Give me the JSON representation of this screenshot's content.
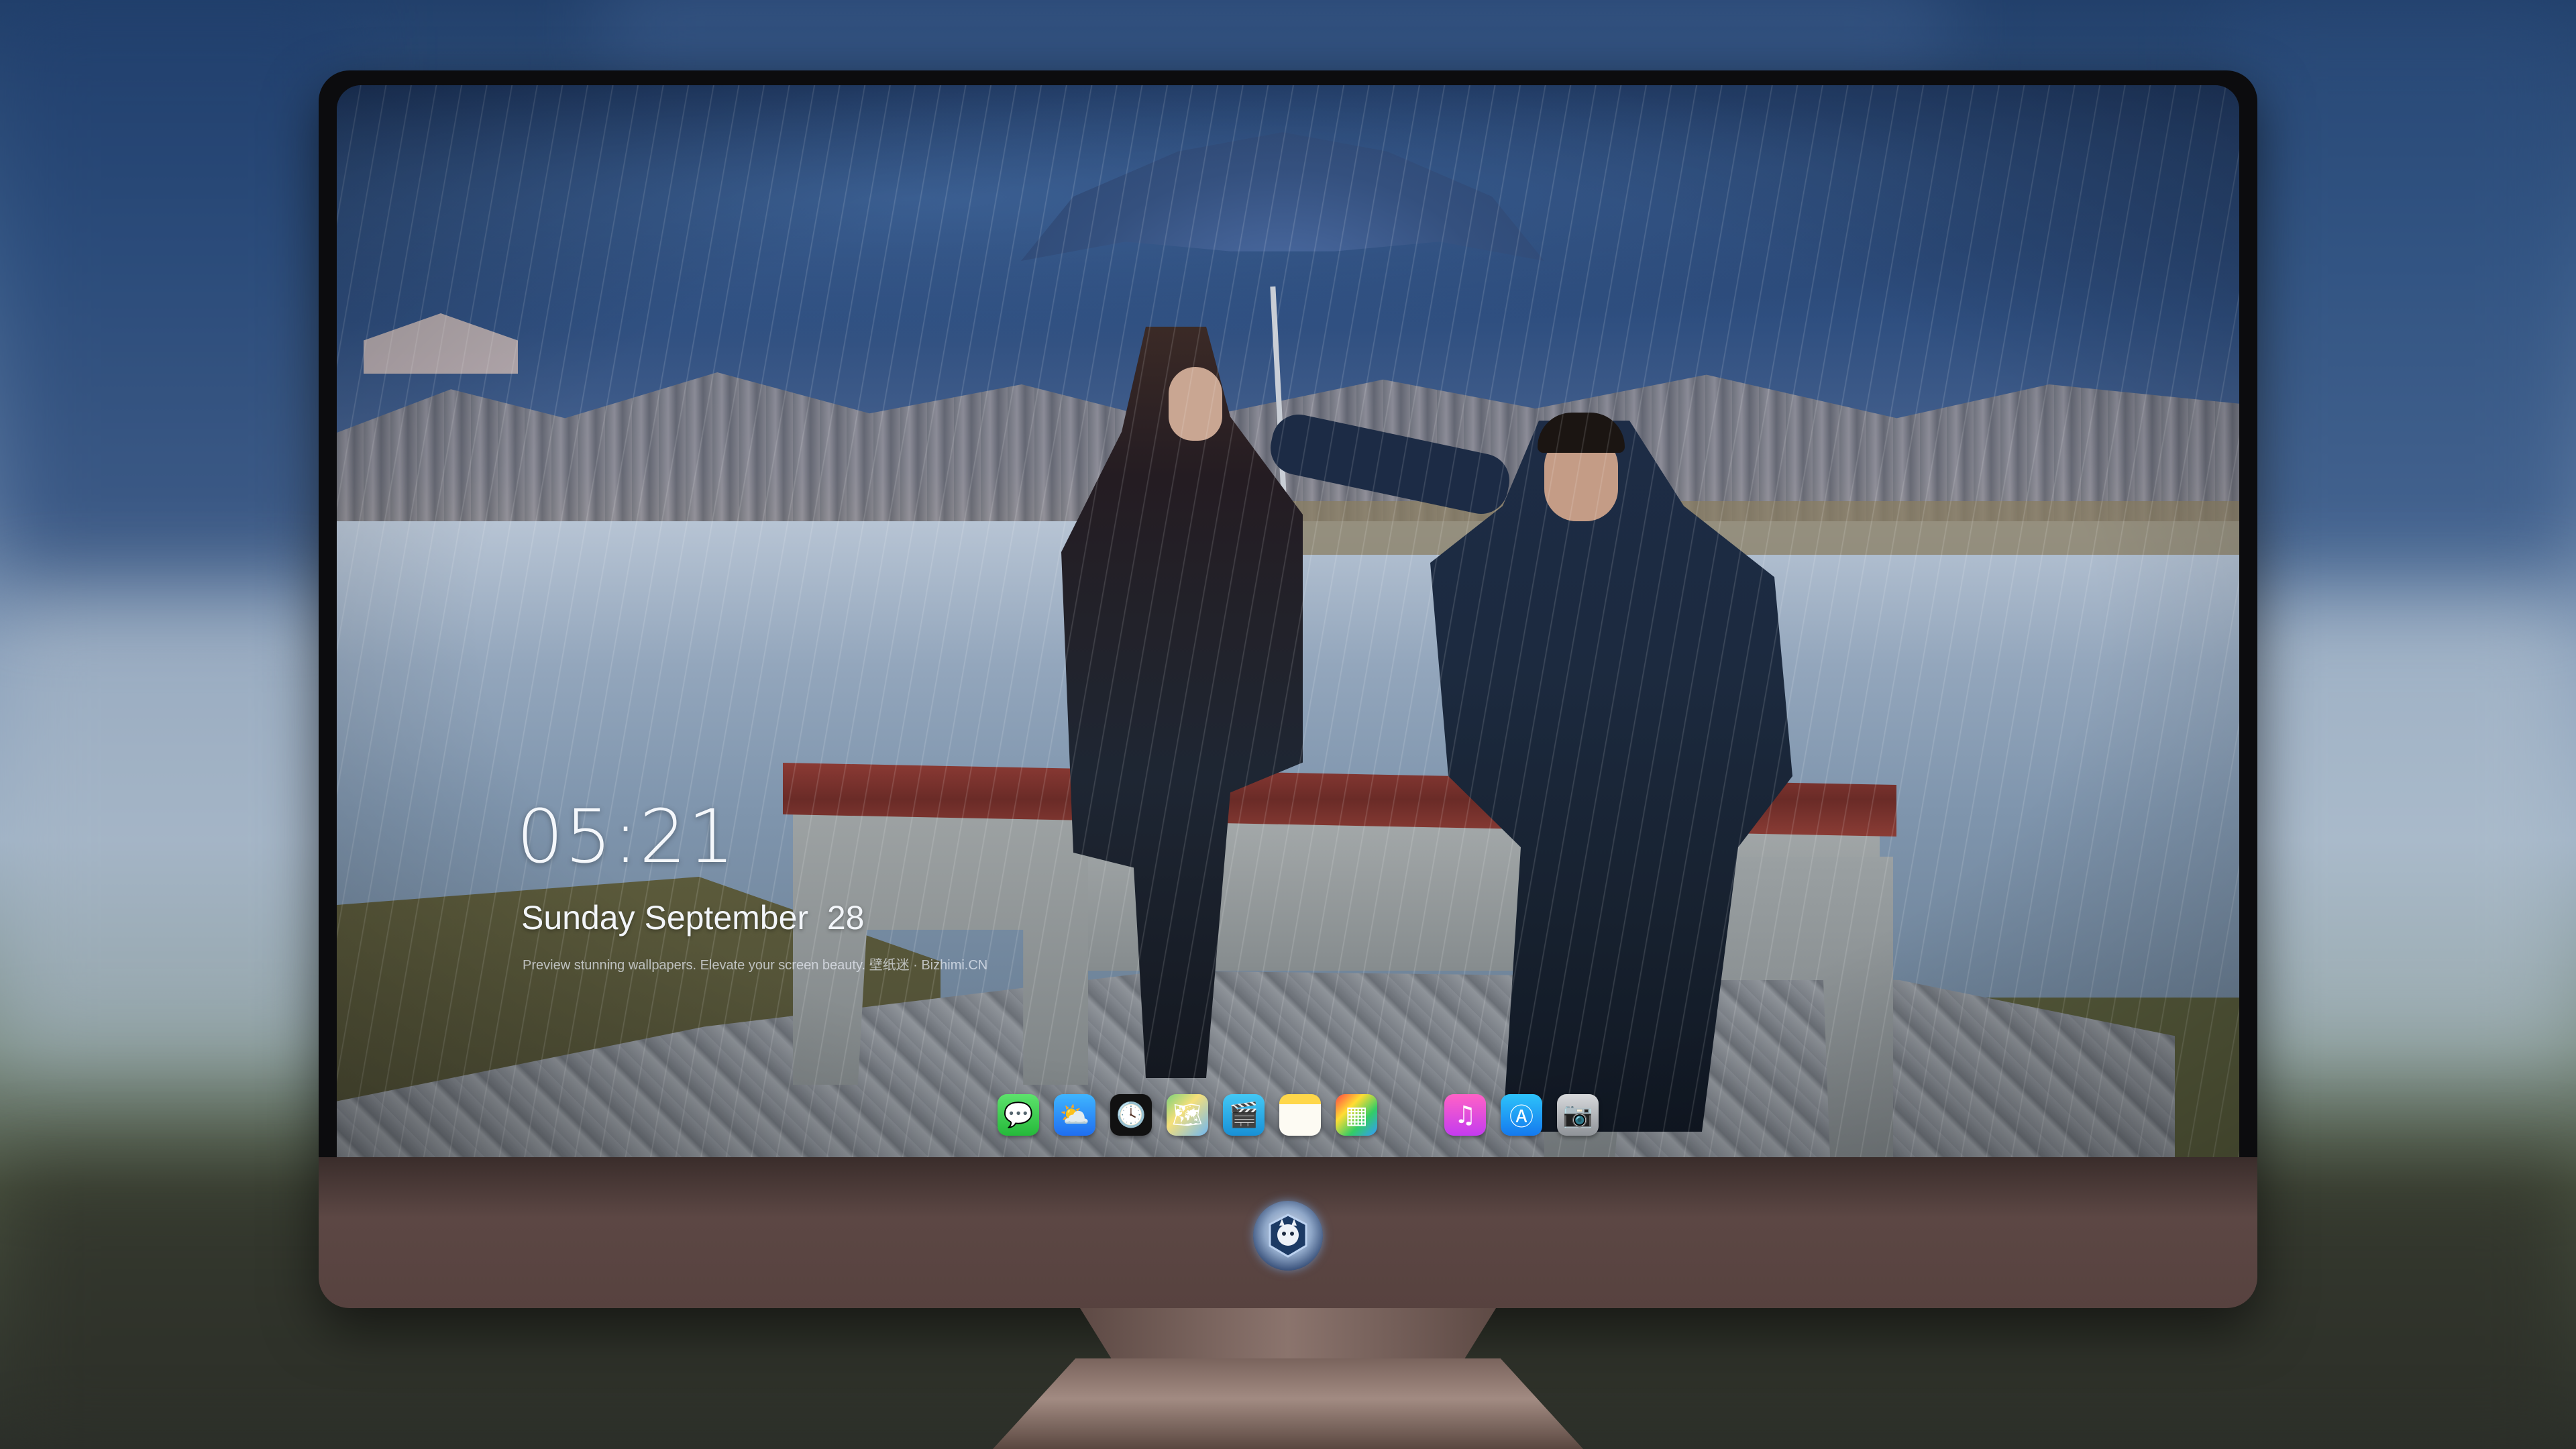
{
  "lock_screen": {
    "time": "05:21",
    "date": "Sunday September  28",
    "credit": "Preview stunning wallpapers. Elevate your screen beauty. 壁纸迷 · Bizhimi.CN"
  },
  "dock": {
    "apps": [
      {
        "name": "Messages",
        "icon": "message-bubble-icon",
        "glyph": "💬"
      },
      {
        "name": "Weather",
        "icon": "weather-cloud-icon",
        "glyph": "⛅"
      },
      {
        "name": "Clock",
        "icon": "clock-icon",
        "glyph": "🕓"
      },
      {
        "name": "Maps",
        "icon": "map-icon",
        "glyph": "🗺"
      },
      {
        "name": "Clips",
        "icon": "clapperboard-icon",
        "glyph": "🎬"
      },
      {
        "name": "Notes",
        "icon": "notes-icon",
        "glyph": ""
      },
      {
        "name": "Photo Booth",
        "icon": "photo-grid-icon",
        "glyph": "▦"
      },
      {
        "name": "Music",
        "icon": "music-note-icon",
        "glyph": "♫"
      },
      {
        "name": "App Store",
        "icon": "app-store-icon",
        "glyph": "Ⓐ"
      },
      {
        "name": "Camera",
        "icon": "camera-icon",
        "glyph": "📷"
      }
    ]
  },
  "colors": {
    "monitor_bezel": "#0c0c0e",
    "monitor_chin": "#57423f",
    "clock_text": "#f4f7fb"
  }
}
